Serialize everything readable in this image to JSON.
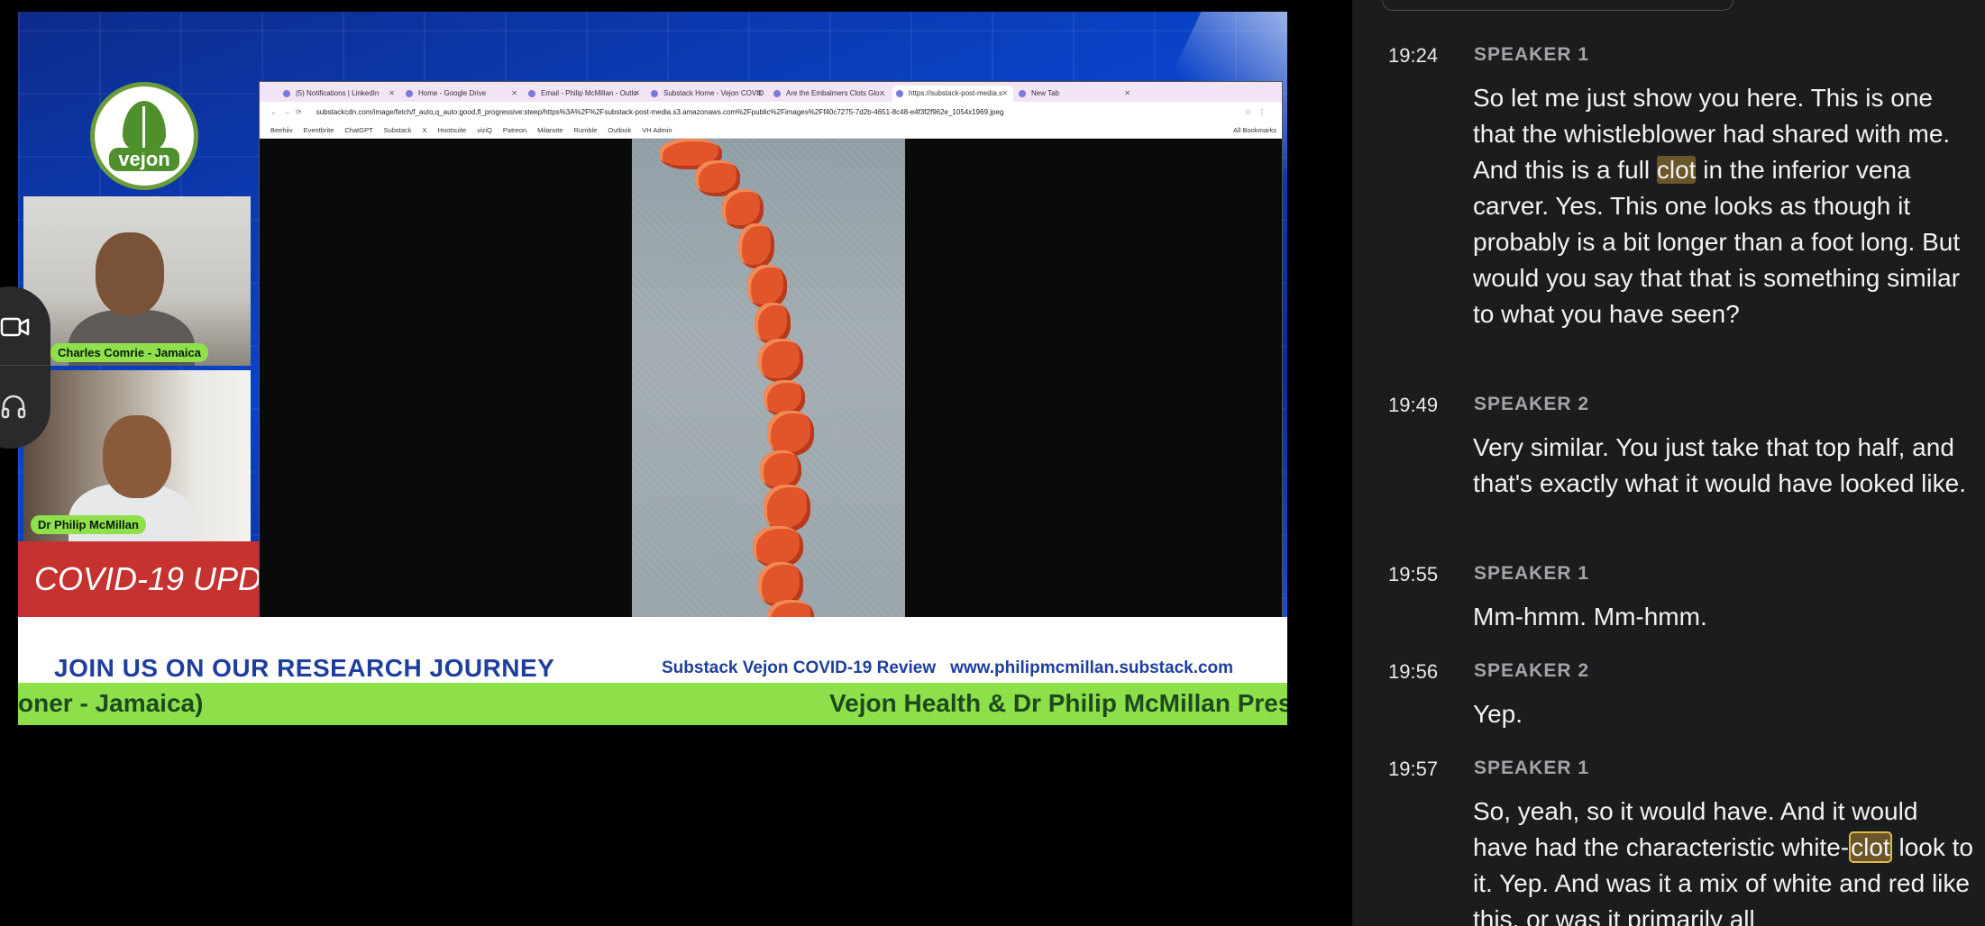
{
  "video": {
    "logo_text": "vejon",
    "participants": [
      {
        "name": "Charles Comrie - Jamaica"
      },
      {
        "name": "Dr Philip McMillan"
      }
    ],
    "covid_banner": "COVID-19 UPD",
    "join_text": "JOIN US ON OUR RESEARCH JOURNEY",
    "substack_text": "Substack Vejon COVID-19 Review",
    "substack_url": "www.philipmcmillan.substack.com",
    "ticker_left": "oner - Jamaica)",
    "ticker_right": "Vejon Health & Dr Philip McMillan Prese",
    "browser": {
      "tabs": [
        {
          "label": "(5) Notifications | LinkedIn",
          "active": false
        },
        {
          "label": "Home - Google Drive",
          "active": false
        },
        {
          "label": "Email - Philip McMillan - Outlo",
          "active": false
        },
        {
          "label": "Substack Home - Vejon COVID",
          "active": false
        },
        {
          "label": "Are the Embalmers Clots Glo...",
          "active": false
        },
        {
          "label": "https://substack-post-media.s",
          "active": true
        },
        {
          "label": "New Tab",
          "active": false
        }
      ],
      "url": "substackcdn.com/image/fetch/f_auto,q_auto:good,fl_progressive:steep/https%3A%2F%2Fsubstack-post-media.s3.amazonaws.com%2Fpublic%2Fimages%2Ff40c7275-7d2b-4651-8c48-e4f3f2f962e_1054x1969.jpeg",
      "bookmarks": [
        "Beehiiv",
        "Eventbrite",
        "ChatGPT",
        "Substack",
        "X",
        "Hootsuite",
        "viziQ",
        "Patreon",
        "Milanote",
        "Rumble",
        "Outlook",
        "VH Admin"
      ],
      "all_bookmarks": "All Bookmarks"
    }
  },
  "transcript": {
    "entries": [
      {
        "time": "19:24",
        "speaker": "SPEAKER 1",
        "before": "So let me just show you here. This is one that the whistleblower had shared with me. And this is a full ",
        "highlight": "clot",
        "after": " in the inferior vena carver. Yes. This one looks as though it probably is a bit longer than a foot long. But would you say that that is something similar to what you have seen?"
      },
      {
        "time": "19:49",
        "speaker": "SPEAKER 2",
        "text": "Very similar. You just take that top half, and that's exactly what it would have looked like."
      },
      {
        "time": "19:55",
        "speaker": "SPEAKER 1",
        "text": "Mm-hmm. Mm-hmm."
      },
      {
        "time": "19:56",
        "speaker": "SPEAKER 2",
        "text": "Yep."
      },
      {
        "time": "19:57",
        "speaker": "SPEAKER 1",
        "before": "So, yeah, so it would have. And it would have had the characteristic white-",
        "highlight": "clot",
        "after": " look to it. Yep. And was it a mix of white and red like this, or was it primarily all"
      }
    ]
  },
  "colors": {
    "highlight": "#6a5628",
    "highlight_border": "#e0b746",
    "ticker_green": "#8ee04a",
    "banner_red": "#c6322f"
  },
  "icons": [
    "video-camera-icon",
    "headphones-icon"
  ]
}
